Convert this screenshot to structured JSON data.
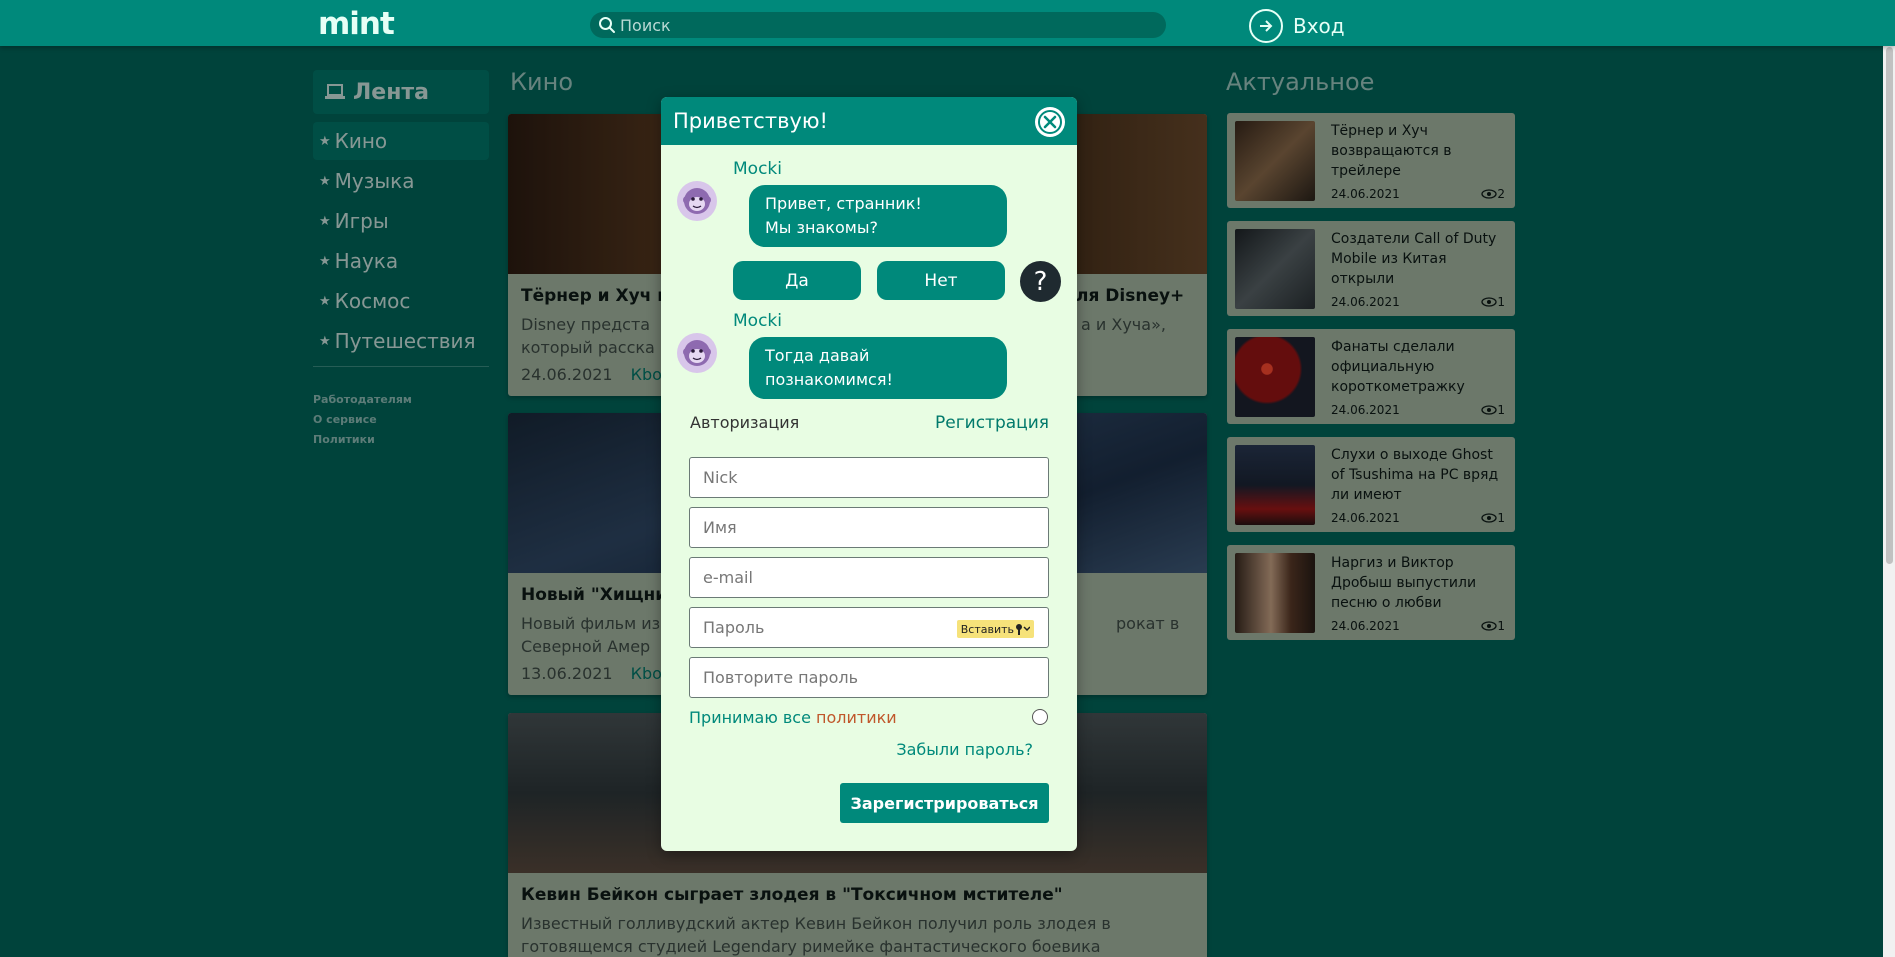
{
  "header": {
    "logo": "mint",
    "search_placeholder": "Поиск",
    "login_label": "Вход"
  },
  "sidebar": {
    "title": "Лента",
    "items": [
      {
        "label": "Кино"
      },
      {
        "label": "Музыка"
      },
      {
        "label": "Игры"
      },
      {
        "label": "Наука"
      },
      {
        "label": "Космос"
      },
      {
        "label": "Путешествия"
      }
    ],
    "links": [
      "Работодателям",
      "О сервисе",
      "Политики"
    ]
  },
  "feed": {
    "section_title": "Кино",
    "cards": [
      {
        "title": "Тёрнер и Хуч в",
        "title_right": "ля Disney+",
        "desc1": "Disney предста",
        "desc1_right": "а и Хуча»,",
        "desc2": "который расска",
        "date": "24.06.2021",
        "link": "Кbod"
      },
      {
        "title": "Новый \"Хищни",
        "desc1": "Новый фильм из",
        "desc1_right": "рокат в",
        "desc2": "Северной Амер",
        "date": "13.06.2021",
        "link": "Кbod"
      },
      {
        "title": "Кевин Бейкон сыграет злодея в \"Токсичном мстителе\"",
        "desc1": "Известный голливудский актер Кевин Бейкон получил роль злодея в",
        "desc2": "готовящемся студией Legendary римейке фантастического боевика"
      }
    ]
  },
  "trending": {
    "section_title": "Актуальное",
    "items": [
      {
        "title": "Тёрнер и Хуч возвращаются в трейлере",
        "date": "24.06.2021",
        "views": "2"
      },
      {
        "title": "Создатели Call of Duty Mobile из Китая открыли",
        "date": "24.06.2021",
        "views": "1"
      },
      {
        "title": "Фанаты сделали официальную короткометражку",
        "date": "24.06.2021",
        "views": "1"
      },
      {
        "title": "Слухи о выходе Ghost of Tsushima на PC вряд ли имеют",
        "date": "24.06.2021",
        "views": "1"
      },
      {
        "title": "Наргиз и Виктор Дробыш выпустили песню о любви",
        "date": "24.06.2021",
        "views": "1"
      }
    ]
  },
  "modal": {
    "title": "Приветствую!",
    "bot_name": "Mocki",
    "message1_line1": "Привет, странник!",
    "message1_line2": "Мы знакомы?",
    "yes_label": "Да",
    "no_label": "Нет",
    "help_label": "?",
    "message2_line1": "Тогда давай",
    "message2_line2": "познакомимся!",
    "tab_auth": "Авторизация",
    "tab_register": "Регистрация",
    "nick_placeholder": "Nick",
    "name_placeholder": "Имя",
    "email_placeholder": "e-mail",
    "password_placeholder": "Пароль",
    "paste_label": "Вставить",
    "repeat_placeholder": "Повторите пароль",
    "accept_text": "Принимаю все",
    "accept_link": "политики",
    "forgot_label": "Забыли пароль?",
    "submit_label": "Зарегистрироваться"
  },
  "colors": {
    "header": "#00897b",
    "background": "#00675b",
    "card": "#a6b8a4",
    "modal": "#e8fde3",
    "accent": "#00897b"
  }
}
